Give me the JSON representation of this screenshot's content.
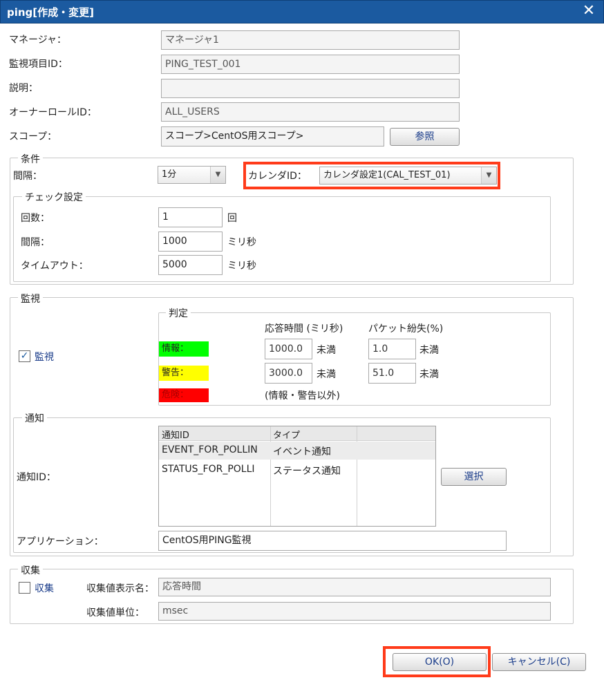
{
  "window": {
    "title": "ping[作成・変更]",
    "close_glyph": "✕"
  },
  "fields": {
    "manager": {
      "label": "マネージャ：",
      "value": "マネージャ1"
    },
    "monitor_id": {
      "label": "監視項目ID：",
      "value": "PING_TEST_001"
    },
    "description": {
      "label": "説明：",
      "value": ""
    },
    "owner_role": {
      "label": "オーナーロールID：",
      "value": "ALL_USERS"
    },
    "scope": {
      "label": "スコープ：",
      "value": "スコープ>CentOS用スコープ>",
      "button": "参照"
    }
  },
  "conditions": {
    "legend": "条件",
    "interval": {
      "label": "間隔：",
      "value": "1分"
    },
    "calendar": {
      "label": "カレンダID：",
      "value": "カレンダ設定1(CAL_TEST_01)"
    },
    "check": {
      "legend": "チェック設定",
      "count": {
        "label": "回数：",
        "value": "1",
        "unit": "回"
      },
      "interval": {
        "label": "間隔：",
        "value": "1000",
        "unit": "ミリ秒"
      },
      "timeout": {
        "label": "タイムアウト：",
        "value": "5000",
        "unit": "ミリ秒"
      }
    }
  },
  "monitor": {
    "legend": "監視",
    "checkbox_label": "監視",
    "checked": true,
    "judgment": {
      "legend": "判定",
      "col_response": "応答時間 (ミリ秒)",
      "col_packet": "パケット紛失(%)",
      "info_label": "情報：",
      "warn_label": "警告：",
      "crit_label": "危険：",
      "info_response": "1000.0",
      "info_packet": "1.0",
      "warn_response": "3000.0",
      "warn_packet": "51.0",
      "less_than": "未満",
      "crit_note": "(情報・警告以外)",
      "colors": {
        "info": "#00ff00",
        "warn": "#ffff00",
        "crit": "#ff0000"
      }
    }
  },
  "notify": {
    "legend": "通知",
    "label": "通知ID：",
    "columns": [
      "通知ID",
      "タイプ",
      ""
    ],
    "rows": [
      [
        "EVENT_FOR_POLLIN",
        "イベント通知"
      ],
      [
        "STATUS_FOR_POLLI",
        "ステータス通知"
      ]
    ],
    "select_button": "選択",
    "app_label": "アプリケーション：",
    "app_value": "CentOS用PING監視"
  },
  "collect": {
    "legend": "収集",
    "checkbox_label": "収集",
    "checked": false,
    "display_name_label": "収集値表示名：",
    "display_name_value": "応答時間",
    "unit_label": "収集値単位：",
    "unit_value": "msec"
  },
  "footer": {
    "ok": "OK(O)",
    "cancel": "キャンセル(C)"
  },
  "highlight_color": "#ff3b1a"
}
